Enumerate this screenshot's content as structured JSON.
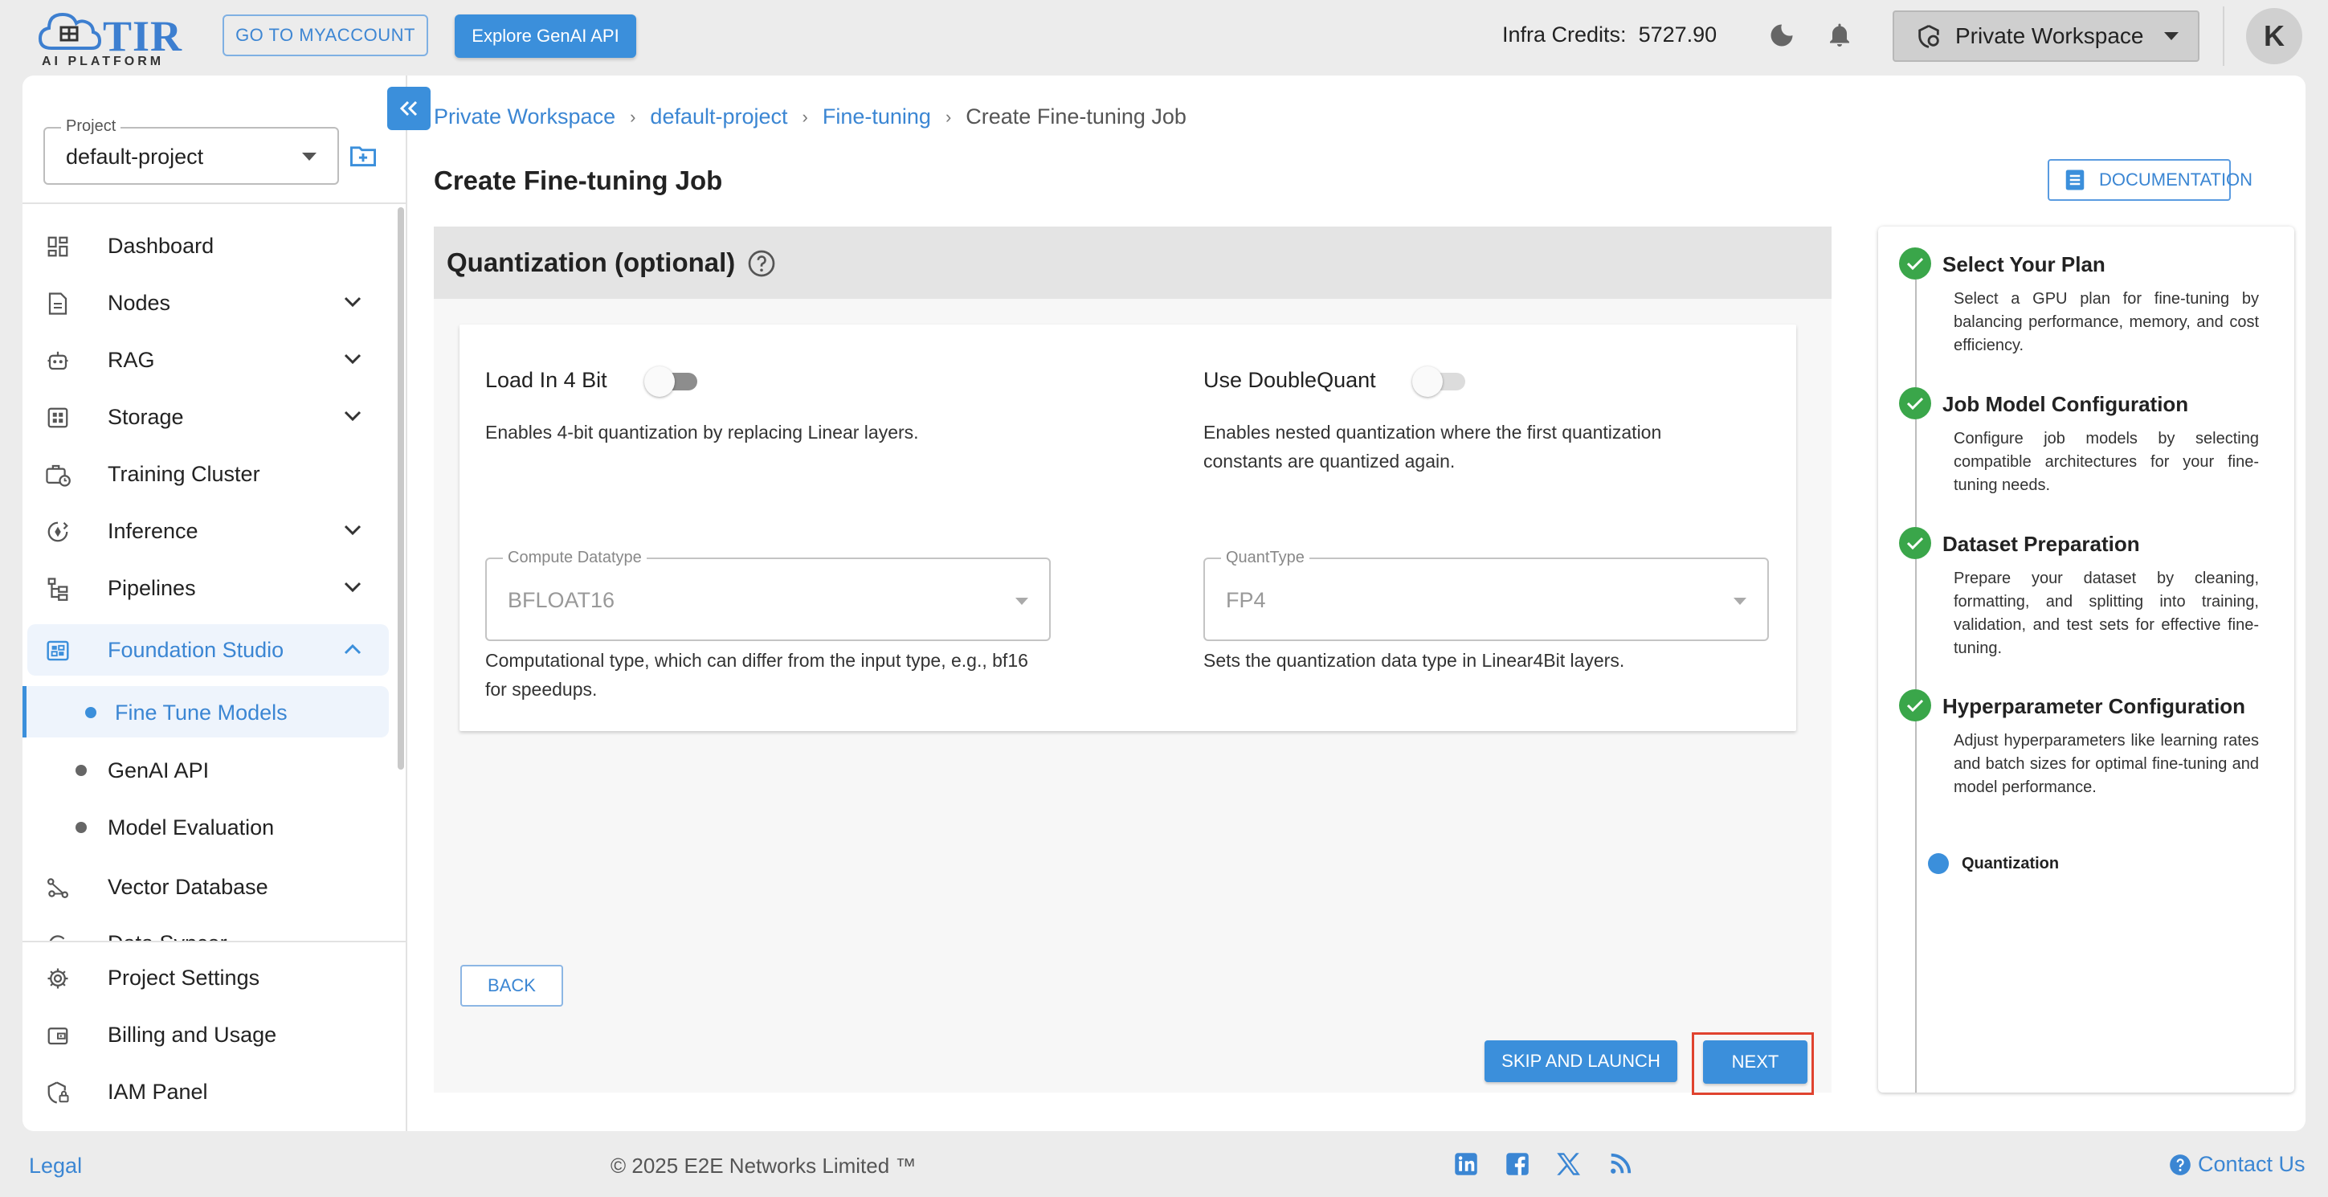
{
  "header": {
    "logo_text": "TIR",
    "logo_subtext": "AI PLATFORM",
    "myaccount_label": "GO TO MYACCOUNT",
    "genai_api_label": "Explore GenAI API",
    "credits_label": "Infra Credits:",
    "credits_value": "5727.90",
    "workspace_label": "Private Workspace",
    "avatar_initial": "K"
  },
  "sidebar": {
    "project_legend": "Project",
    "project_value": "default-project",
    "items": [
      {
        "label": "Dashboard"
      },
      {
        "label": "Nodes"
      },
      {
        "label": "RAG"
      },
      {
        "label": "Storage"
      },
      {
        "label": "Training Cluster"
      },
      {
        "label": "Inference"
      },
      {
        "label": "Pipelines"
      },
      {
        "label": "Foundation Studio"
      },
      {
        "label": "Fine Tune Models"
      },
      {
        "label": "GenAI API"
      },
      {
        "label": "Model Evaluation"
      },
      {
        "label": "Vector Database"
      },
      {
        "label": "Data Syncer"
      }
    ],
    "bottom_items": [
      {
        "label": "Project Settings"
      },
      {
        "label": "Billing and Usage"
      },
      {
        "label": "IAM Panel"
      }
    ]
  },
  "breadcrumb": {
    "items": [
      "Private Workspace",
      "default-project",
      "Fine-tuning"
    ],
    "current": "Create Fine-tuning Job"
  },
  "page": {
    "title": "Create Fine-tuning Job",
    "documentation_label": "DOCUMENTATION"
  },
  "quantization": {
    "title": "Quantization (optional)",
    "load_4bit": {
      "label": "Load In 4 Bit",
      "enabled": false,
      "help": "Enables 4-bit quantization by replacing Linear layers."
    },
    "double_quant": {
      "label": "Use DoubleQuant",
      "enabled": false,
      "help": "Enables nested quantization where the first quantization constants are quantized again."
    },
    "compute_dtype": {
      "legend": "Compute Datatype",
      "value": "BFLOAT16",
      "help": "Computational type, which can differ from the input type, e.g., bf16 for speedups."
    },
    "quant_type": {
      "legend": "QuantType",
      "value": "FP4",
      "help": "Sets the quantization data type in Linear4Bit layers."
    }
  },
  "actions": {
    "back_label": "BACK",
    "skip_label": "SKIP AND LAUNCH",
    "next_label": "NEXT"
  },
  "stepper": {
    "steps": [
      {
        "title": "Select Your Plan",
        "desc": "Select a GPU plan for fine-tuning by balancing performance, memory, and cost efficiency."
      },
      {
        "title": "Job Model Configuration",
        "desc": "Configure job models by selecting compatible architectures for your fine-tuning needs."
      },
      {
        "title": "Dataset Preparation",
        "desc": "Prepare your dataset by cleaning, formatting, and splitting into training, validation, and test sets for effective fine-tuning."
      },
      {
        "title": "Hyperparameter Configuration",
        "desc": "Adjust hyperparameters like learning rates and batch sizes for optimal fine-tuning and model performance."
      }
    ],
    "current": "Quantization"
  },
  "footer": {
    "legal": "Legal",
    "copyright": "© 2025 E2E Networks Limited ™",
    "contact": "Contact Us"
  },
  "colors": {
    "accent": "#3b8fdb",
    "success": "#3aa64a",
    "highlight": "#e0432f"
  }
}
